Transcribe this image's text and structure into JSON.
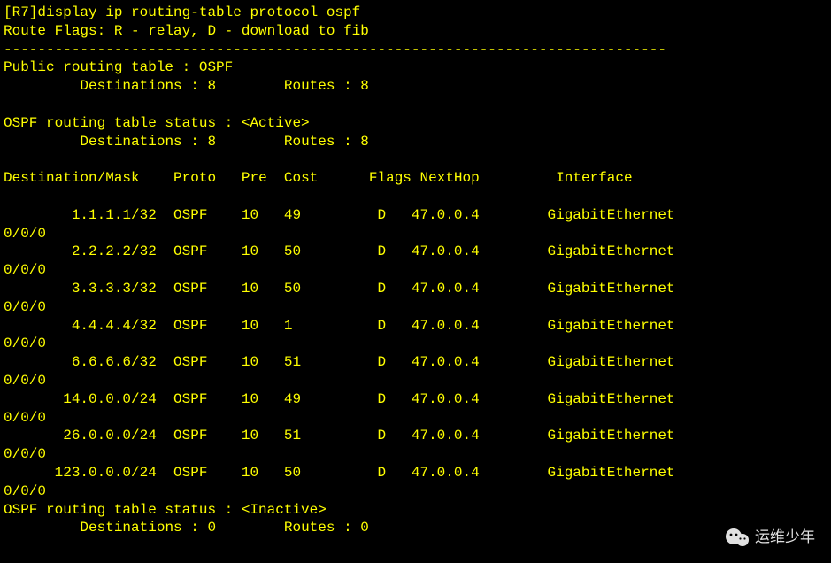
{
  "prompt": "[R7]",
  "command": "display ip routing-table protocol ospf",
  "route_flags_line": "Route Flags: R - relay, D - download to fib",
  "divider": "------------------------------------------------------------------------------",
  "public_table": {
    "title": "Public routing table : OSPF",
    "dest_label": "Destinations :",
    "dest_count": "8",
    "routes_label": "Routes :",
    "routes_count": "8"
  },
  "active_status": {
    "title": "OSPF routing table status : <Active>",
    "dest_label": "Destinations :",
    "dest_count": "8",
    "routes_label": "Routes :",
    "routes_count": "8"
  },
  "headers": {
    "dest": "Destination/Mask",
    "proto": "Proto",
    "pre": "Pre",
    "cost": "Cost",
    "flags": "Flags",
    "nexthop": "NextHop",
    "iface": "Interface"
  },
  "routes": [
    {
      "dest": "1.1.1.1/32",
      "proto": "OSPF",
      "pre": "10",
      "cost": "49",
      "flags": "D",
      "nexthop": "47.0.0.4",
      "iface": "GigabitEthernet",
      "wrap": "0/0/0"
    },
    {
      "dest": "2.2.2.2/32",
      "proto": "OSPF",
      "pre": "10",
      "cost": "50",
      "flags": "D",
      "nexthop": "47.0.0.4",
      "iface": "GigabitEthernet",
      "wrap": "0/0/0"
    },
    {
      "dest": "3.3.3.3/32",
      "proto": "OSPF",
      "pre": "10",
      "cost": "50",
      "flags": "D",
      "nexthop": "47.0.0.4",
      "iface": "GigabitEthernet",
      "wrap": "0/0/0"
    },
    {
      "dest": "4.4.4.4/32",
      "proto": "OSPF",
      "pre": "10",
      "cost": "1",
      "flags": "D",
      "nexthop": "47.0.0.4",
      "iface": "GigabitEthernet",
      "wrap": "0/0/0"
    },
    {
      "dest": "6.6.6.6/32",
      "proto": "OSPF",
      "pre": "10",
      "cost": "51",
      "flags": "D",
      "nexthop": "47.0.0.4",
      "iface": "GigabitEthernet",
      "wrap": "0/0/0"
    },
    {
      "dest": "14.0.0.0/24",
      "proto": "OSPF",
      "pre": "10",
      "cost": "49",
      "flags": "D",
      "nexthop": "47.0.0.4",
      "iface": "GigabitEthernet",
      "wrap": "0/0/0"
    },
    {
      "dest": "26.0.0.0/24",
      "proto": "OSPF",
      "pre": "10",
      "cost": "51",
      "flags": "D",
      "nexthop": "47.0.0.4",
      "iface": "GigabitEthernet",
      "wrap": "0/0/0"
    },
    {
      "dest": "123.0.0.0/24",
      "proto": "OSPF",
      "pre": "10",
      "cost": "50",
      "flags": "D",
      "nexthop": "47.0.0.4",
      "iface": "GigabitEthernet",
      "wrap": "0/0/0"
    }
  ],
  "inactive_status": {
    "title": "OSPF routing table status : <Inactive>",
    "dest_label": "Destinations :",
    "dest_count": "0",
    "routes_label": "Routes :",
    "routes_count": "0"
  },
  "watermark": {
    "text": "运维少年"
  }
}
